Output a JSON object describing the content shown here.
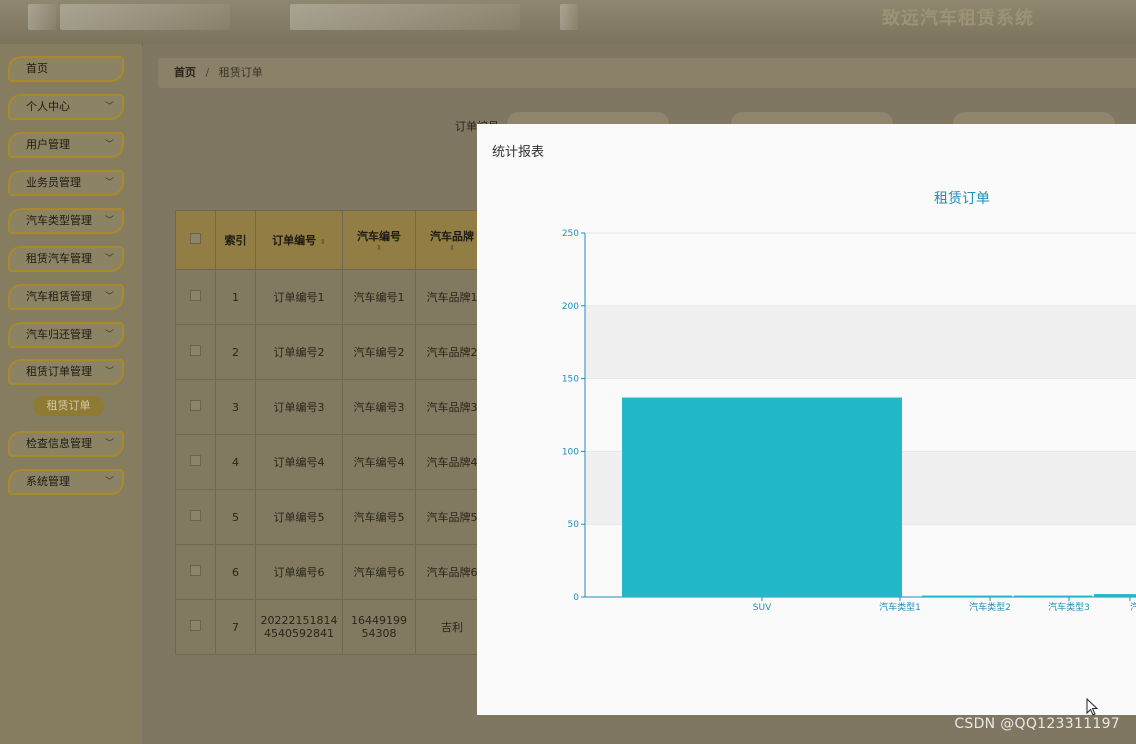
{
  "app": {
    "title": "致远汽车租赁系统"
  },
  "sidebar": {
    "items": [
      {
        "label": "首页",
        "has_arrow": false
      },
      {
        "label": "个人中心",
        "has_arrow": true
      },
      {
        "label": "用户管理",
        "has_arrow": true
      },
      {
        "label": "业务员管理",
        "has_arrow": true
      },
      {
        "label": "汽车类型管理",
        "has_arrow": true
      },
      {
        "label": "租赁汽车管理",
        "has_arrow": true
      },
      {
        "label": "汽车租赁管理",
        "has_arrow": true
      },
      {
        "label": "汽车归还管理",
        "has_arrow": true
      },
      {
        "label": "租赁订单管理",
        "has_arrow": true
      },
      {
        "label": "检查信息管理",
        "has_arrow": true
      },
      {
        "label": "系统管理",
        "has_arrow": true
      }
    ],
    "active_sub": "租赁订单"
  },
  "breadcrumb": {
    "home": "首页",
    "separator": "/",
    "current": "租赁订单"
  },
  "search": {
    "label1": "订单编号"
  },
  "table": {
    "headers": [
      "索引",
      "订单编号",
      "汽车编号",
      "汽车品牌"
    ],
    "rows": [
      [
        "1",
        "订单编号1",
        "汽车编号1",
        "汽车品牌1"
      ],
      [
        "2",
        "订单编号2",
        "汽车编号2",
        "汽车品牌2"
      ],
      [
        "3",
        "订单编号3",
        "汽车编号3",
        "汽车品牌3"
      ],
      [
        "4",
        "订单编号4",
        "汽车编号4",
        "汽车品牌4"
      ],
      [
        "5",
        "订单编号5",
        "汽车编号5",
        "汽车品牌5"
      ],
      [
        "6",
        "订单编号6",
        "汽车编号6",
        "汽车品牌6"
      ],
      [
        "7",
        "20222151814\n4540592841",
        "16449199\n54308",
        "吉利"
      ]
    ]
  },
  "modal": {
    "title": "统计报表"
  },
  "chart_data": {
    "type": "bar",
    "title": "租赁订单",
    "categories": [
      "SUV",
      "汽车类型1",
      "汽车类型2",
      "汽车类型3",
      "汽"
    ],
    "values": [
      137,
      1,
      1,
      2,
      3
    ],
    "ylim": [
      0,
      250
    ],
    "yticks": [
      0,
      50,
      100,
      150,
      200,
      250
    ],
    "bar_color": "#23b7c9",
    "axis_color": "#1f8fbd"
  },
  "watermark": "CSDN @QQ123311197"
}
